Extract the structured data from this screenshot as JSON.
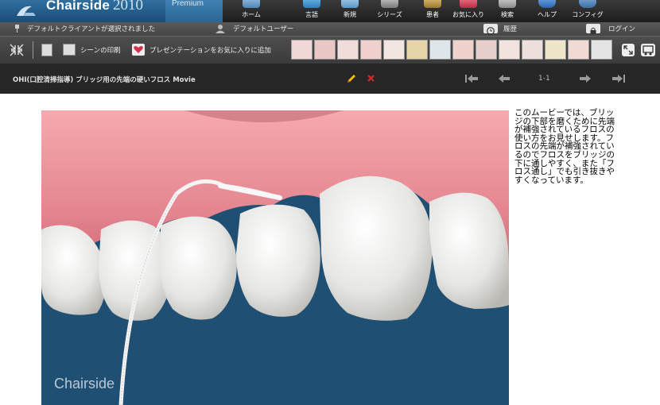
{
  "app": {
    "logo_text": "Chairside",
    "logo_year": "2010",
    "edition_badge": "Premium",
    "video_watermark": "Chairside"
  },
  "nav": {
    "items": [
      {
        "label": "ホーム",
        "icon": "home-icon"
      },
      {
        "label": "言語",
        "icon": "globe-icon"
      },
      {
        "label": "新規",
        "icon": "new-icon"
      },
      {
        "label": "シリーズ",
        "icon": "series-icon"
      },
      {
        "label": "患者",
        "icon": "patient-icon"
      },
      {
        "label": "お気に入り",
        "icon": "favorites-icon"
      },
      {
        "label": "検索",
        "icon": "search-icon"
      },
      {
        "label": "ヘルプ",
        "icon": "help-icon"
      },
      {
        "label": "コンフィグ",
        "icon": "gear-icon"
      }
    ]
  },
  "status": {
    "client": "デフォルトクライアントが選択されました",
    "user": "デフォルトユーザー",
    "history": "履歴",
    "login": "ログイン"
  },
  "toolbar": {
    "print_scene": "シーンの印刷",
    "add_to_favorites": "プレゼンテーションをお気に入りに追加"
  },
  "movie": {
    "title": "OHI(口腔清掃指導) ブリッジ用の先端の硬いフロス Movie",
    "page": "1-1",
    "description": "このムービーでは、ブリッジの下部を磨くために先端が補強されているフロスの使い方をお見せします。フロスの先端が補強されているのでフロスをブリッジの下に通しやすく、また「フロス通し」でも引き抜きやすくなっています。"
  }
}
